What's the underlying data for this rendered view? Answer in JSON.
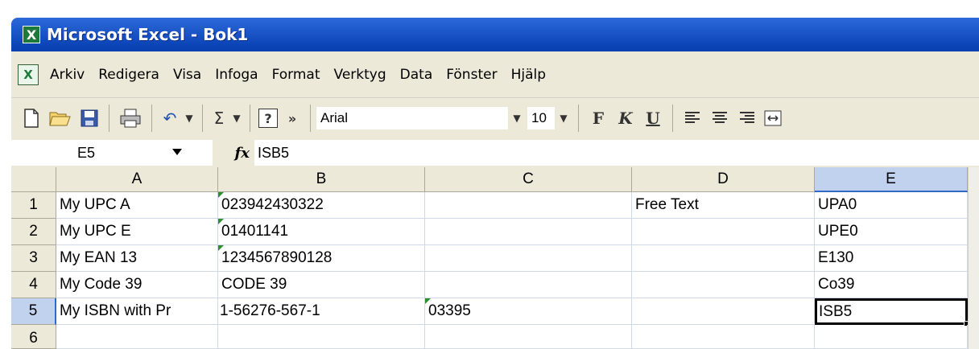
{
  "window": {
    "title": "Microsoft Excel - Bok1",
    "app_icon": "excel-icon"
  },
  "menu": {
    "items": [
      "Arkiv",
      "Redigera",
      "Visa",
      "Infoga",
      "Format",
      "Verktyg",
      "Data",
      "Fönster",
      "Hjälp"
    ]
  },
  "toolbar": {
    "font_name": "Arial",
    "font_size": "10",
    "bold": "F",
    "italic": "K",
    "underline": "U",
    "sum": "Σ",
    "help": "?",
    "more": "»"
  },
  "formula_bar": {
    "name_box": "E5",
    "fx": "fx",
    "value": "ISB5"
  },
  "sheet": {
    "columns": [
      "A",
      "B",
      "C",
      "D",
      "E"
    ],
    "rows": [
      "1",
      "2",
      "3",
      "4",
      "5",
      "6"
    ],
    "cells": {
      "A1": "My UPC A",
      "B1": "023942430322",
      "C1": "",
      "D1": "Free Text",
      "E1": "UPA0",
      "A2": "My UPC E",
      "B2": "01401141",
      "C2": "",
      "D2": "",
      "E2": "UPE0",
      "A3": "My EAN 13",
      "B3": "1234567890128",
      "C3": "",
      "D3": "",
      "E3": "E130",
      "A4": "My Code 39",
      "B4": "CODE 39",
      "C4": "",
      "D4": "",
      "E4": "Co39",
      "A5": "My ISBN with Pr",
      "B5": "1-56276-567-1",
      "C5": "03395",
      "D5": "",
      "E5": "ISB5"
    },
    "active_cell": "E5",
    "colors": {
      "selection_header": "#c1d2ee",
      "gridline": "#d0d7e5",
      "error_triangle": "#2f8f2f"
    }
  }
}
